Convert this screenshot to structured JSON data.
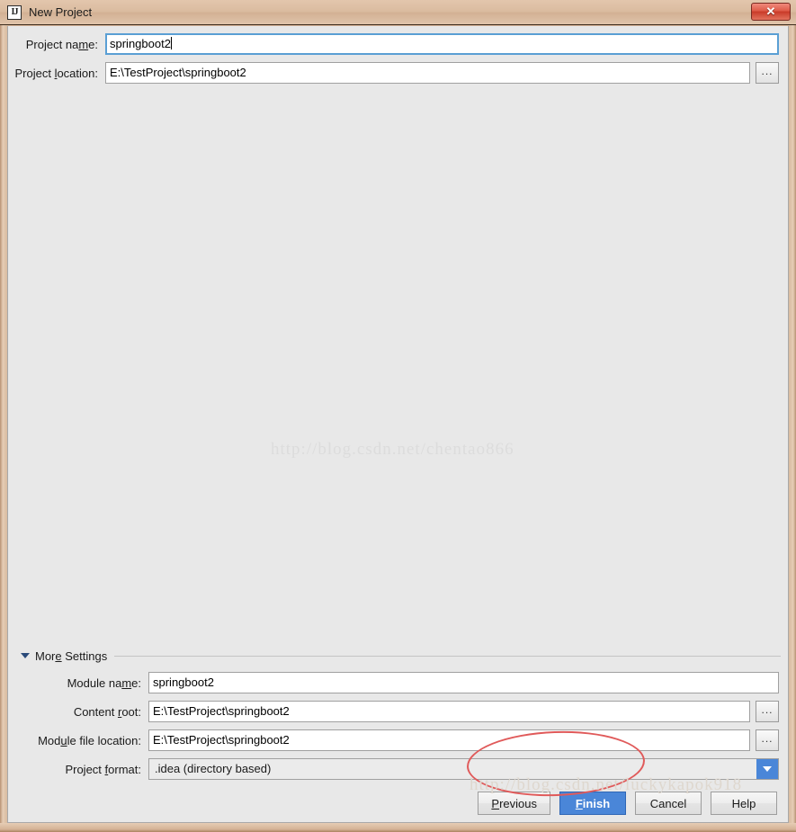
{
  "window": {
    "title": "New Project",
    "icon": "intellij-idea-icon",
    "close_label": "✕"
  },
  "top_fields": [
    {
      "label_pre": "Project na",
      "label_mnemonic": "m",
      "label_post": "e:",
      "value": "springboot2",
      "focused": true,
      "has_browse": false
    },
    {
      "label_pre": "Project ",
      "label_mnemonic": "l",
      "label_post": "ocation:",
      "value": "E:\\TestProject\\springboot2",
      "focused": false,
      "has_browse": true,
      "browse_label": "..."
    }
  ],
  "watermarks": {
    "center": "http://blog.csdn.net/chentao866",
    "bottom": "http://blog.csdn.net/luckykapok918"
  },
  "more_settings": {
    "title_pre": "Mor",
    "title_mnemonic": "e",
    "title_post": " Settings",
    "expanded": true,
    "rows": [
      {
        "label_pre": "Module na",
        "label_mnemonic": "m",
        "label_post": "e:",
        "value": "springboot2",
        "type": "text",
        "has_browse": false
      },
      {
        "label_pre": "Content ",
        "label_mnemonic": "r",
        "label_post": "oot:",
        "value": "E:\\TestProject\\springboot2",
        "type": "text",
        "has_browse": true,
        "browse_label": "..."
      },
      {
        "label_pre": "Mod",
        "label_mnemonic": "u",
        "label_post": "le file location:",
        "value": "E:\\TestProject\\springboot2",
        "type": "text",
        "has_browse": true,
        "browse_label": "..."
      },
      {
        "label_pre": "Project ",
        "label_mnemonic": "f",
        "label_post": "ormat:",
        "value": ".idea (directory based)",
        "type": "combo",
        "has_browse": false
      }
    ]
  },
  "buttons": [
    {
      "pre": "",
      "mnemonic": "P",
      "post": "revious",
      "primary": false
    },
    {
      "pre": "",
      "mnemonic": "F",
      "post": "inish",
      "primary": true
    },
    {
      "pre": "Cancel",
      "mnemonic": "",
      "post": "",
      "primary": false
    },
    {
      "pre": "Help",
      "mnemonic": "",
      "post": "",
      "primary": false
    }
  ],
  "colors": {
    "accent_blue": "#4a86d8",
    "focus_border": "#5a9fd4",
    "panel_bg": "#e8e8e8",
    "titlebar": "#dabb9f",
    "annotation_red": "#e05a5a"
  }
}
